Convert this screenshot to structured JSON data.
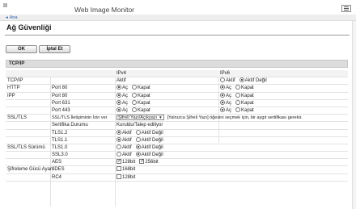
{
  "app": {
    "title": "Web Image Monitor",
    "back_label": "Ana"
  },
  "page": {
    "title": "Ağ Güvenliği"
  },
  "toolbar": {
    "ok_label": "OK",
    "cancel_label": "İptal Et"
  },
  "section": {
    "title": "TCP/IP"
  },
  "columns": {
    "ipv4": "IPv4",
    "ipv6": "IPv6"
  },
  "opts": {
    "on": "Aç",
    "off": "Kapat",
    "active": "Aktif",
    "inactive": "Aktif Değil"
  },
  "rows": {
    "tcpip": {
      "label": "TCP/IP",
      "ipv4": "Aktif"
    },
    "http": {
      "label": "HTTP",
      "port80": "Port 80"
    },
    "ipp": {
      "label": "IPP",
      "port80": "Port 80",
      "port631": "Port 631"
    },
    "ssl": {
      "label": "SSL/TLS",
      "port443": "Port 443",
      "comm_label": "SSL/TLS İletişiminin İzin ver",
      "comm_value": "Şifreli Yazı/Açıkyazı",
      "comm_note": "[Yalnızca Şifreli Yazı] öğesini seçmek için, bir aygıt sertifikası gerekir.",
      "cert_label": "Sertifika Durumu",
      "cert_value": "Kuruldu/Talep ediliyor"
    },
    "tls": {
      "label": "SSL/TLS Sürümü",
      "v12": "TLS1.2",
      "v11": "TLS1.1",
      "v10": "TLS1.0",
      "ssl30": "SSL3.0"
    },
    "cipher": {
      "label": "Şifreleme Gücü Ayarı",
      "aes": "AES",
      "des": "3DES",
      "rc4": "RC4",
      "b128": "128bit",
      "b256": "256bit",
      "b168": "168bit"
    }
  }
}
